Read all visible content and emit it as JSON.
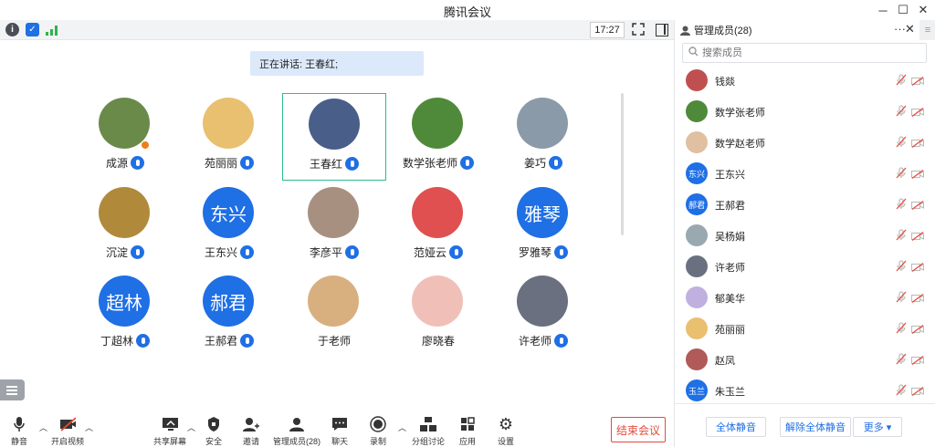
{
  "window": {
    "title": "腾讯会议",
    "controls": [
      "minimize",
      "maximize",
      "close"
    ]
  },
  "topbar": {
    "clock": "17:27"
  },
  "stage": {
    "speaking_label": "正在讲话: 王春红;",
    "participants": [
      {
        "name": "成源",
        "avatar_color": "#6a8a4a"
      },
      {
        "name": "苑丽丽",
        "avatar_color": "#e8c070"
      },
      {
        "name": "王春红",
        "avatar_color": "#4a5e8a",
        "active": true
      },
      {
        "name": "数学张老师",
        "avatar_color": "#4f8a3a"
      },
      {
        "name": "姜巧",
        "avatar_color": "#8a9aa8"
      },
      {
        "name": "沉淀",
        "avatar_color": "#b08a3a"
      },
      {
        "name": "王东兴",
        "avatar_text": "东兴",
        "avatar_color": "#1f6fe5"
      },
      {
        "name": "李彦平",
        "avatar_color": "#a89080"
      },
      {
        "name": "范娅云",
        "avatar_color": "#e05050"
      },
      {
        "name": "罗雅琴",
        "avatar_text": "雅琴",
        "avatar_color": "#1f6fe5"
      },
      {
        "name": "丁超林",
        "avatar_text": "超林",
        "avatar_color": "#1f6fe5"
      },
      {
        "name": "王郝君",
        "avatar_text": "郝君",
        "avatar_color": "#1f6fe5"
      },
      {
        "name": "于老师",
        "avatar_color": "#d8b080",
        "no_mic": true
      },
      {
        "name": "廖晓春",
        "avatar_color": "#f0c0b8",
        "no_mic": true
      },
      {
        "name": "许老师",
        "avatar_color": "#6a7080"
      }
    ]
  },
  "toolbar": {
    "mute": "静音",
    "video": "开启视频",
    "share": "共享屏幕",
    "security": "安全",
    "invite": "邀请",
    "members": "管理成员(28)",
    "chat": "聊天",
    "record": "录制",
    "breakout": "分组讨论",
    "apps": "应用",
    "settings": "设置",
    "end": "结束会议"
  },
  "panel": {
    "title": "管理成员(28)",
    "search_placeholder": "搜索成员",
    "members": [
      {
        "name": "钱燚",
        "avatar_color": "#c05050"
      },
      {
        "name": "数学张老师",
        "avatar_color": "#4f8a3a"
      },
      {
        "name": "数学赵老师",
        "avatar_color": "#e0c0a0"
      },
      {
        "name": "王东兴",
        "avatar_text": "东兴",
        "avatar_color": "#1f6fe5"
      },
      {
        "name": "王郝君",
        "avatar_text": "郝君",
        "avatar_color": "#1f6fe5"
      },
      {
        "name": "吴杨娟",
        "avatar_color": "#9aa8b0"
      },
      {
        "name": "许老师",
        "avatar_color": "#6a7080"
      },
      {
        "name": "郁美华",
        "avatar_color": "#c0b0e0"
      },
      {
        "name": "苑丽丽",
        "avatar_color": "#e8c070"
      },
      {
        "name": "赵凤",
        "avatar_color": "#b05a5a"
      },
      {
        "name": "朱玉兰",
        "avatar_text": "玉兰",
        "avatar_color": "#1f6fe5"
      }
    ],
    "mute_all": "全体静音",
    "unmute_all": "解除全体静音",
    "more": "更多 ▾"
  }
}
